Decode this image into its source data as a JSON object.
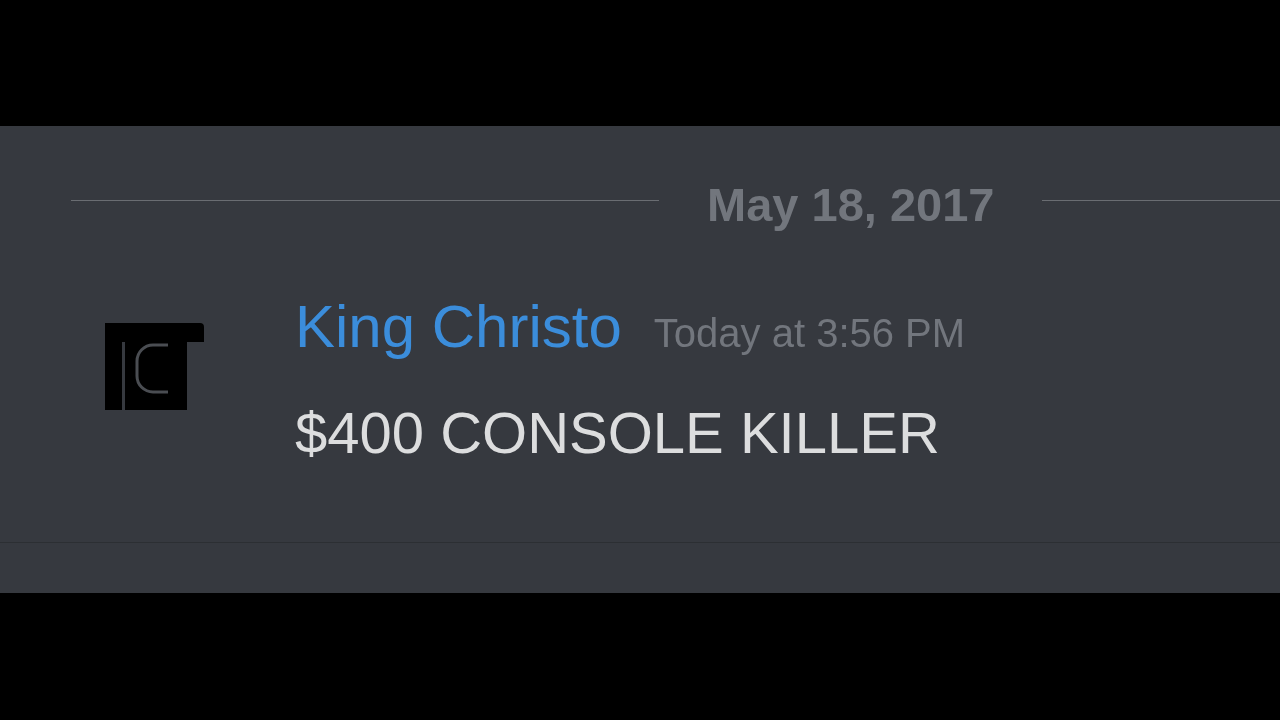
{
  "date_divider": {
    "label": "May 18, 2017"
  },
  "message": {
    "author": "King Christo",
    "timestamp": "Today at 3:56 PM",
    "text": "$400 CONSOLE KILLER"
  }
}
